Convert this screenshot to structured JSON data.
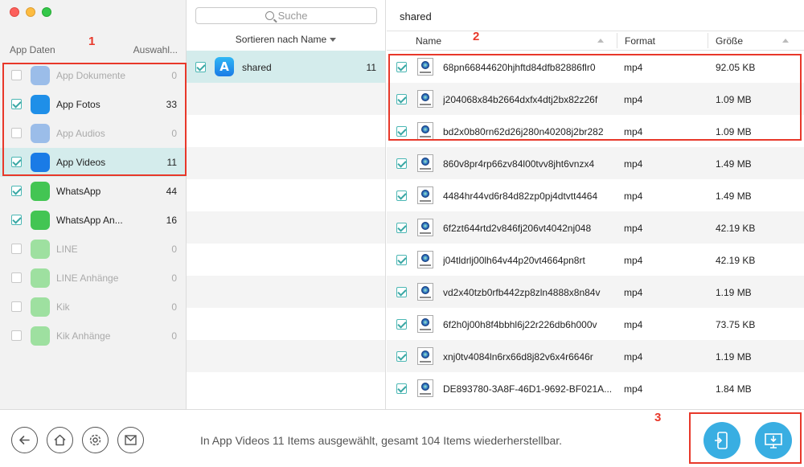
{
  "window": {
    "controls": [
      "close",
      "minimize",
      "maximize"
    ]
  },
  "left": {
    "header_name": "App Daten",
    "header_select": "Auswahl...",
    "categories": [
      {
        "label": "App Dokumente",
        "count": "0",
        "checked": false,
        "disabled": true,
        "icon": "document-icon",
        "color": "#9bbde9"
      },
      {
        "label": "App Fotos",
        "count": "33",
        "checked": true,
        "disabled": false,
        "icon": "photos-icon",
        "color": "#1f8fe8"
      },
      {
        "label": "App Audios",
        "count": "0",
        "checked": false,
        "disabled": true,
        "icon": "audio-icon",
        "color": "#9bbde9"
      },
      {
        "label": "App Videos",
        "count": "11",
        "checked": true,
        "disabled": false,
        "selected": true,
        "icon": "video-icon",
        "color": "#1a7be6"
      },
      {
        "label": "WhatsApp",
        "count": "44",
        "checked": true,
        "disabled": false,
        "icon": "whatsapp-icon",
        "color": "#43c553"
      },
      {
        "label": "WhatsApp An...",
        "count": "16",
        "checked": true,
        "disabled": false,
        "icon": "whatsapp-attachment-icon",
        "color": "#43c553"
      },
      {
        "label": "LINE",
        "count": "0",
        "checked": false,
        "disabled": true,
        "icon": "line-icon",
        "color": "#9ee0a0"
      },
      {
        "label": "LINE Anhänge",
        "count": "0",
        "checked": false,
        "disabled": true,
        "icon": "line-attachment-icon",
        "color": "#9ee0a0"
      },
      {
        "label": "Kik",
        "count": "0",
        "checked": false,
        "disabled": true,
        "icon": "kik-icon",
        "color": "#9ee0a0"
      },
      {
        "label": "Kik Anhänge",
        "count": "0",
        "checked": false,
        "disabled": true,
        "icon": "kik-attachment-icon",
        "color": "#9ee0a0"
      }
    ]
  },
  "middle": {
    "search_placeholder": "Suche",
    "sort_label": "Sortieren nach Name",
    "folders": [
      {
        "label": "shared",
        "count": "11",
        "checked": true,
        "selected": true,
        "icon": "appstore-icon",
        "glyph": "A"
      }
    ]
  },
  "right": {
    "title": "shared",
    "columns": {
      "name": "Name",
      "format": "Format",
      "size": "Größe"
    },
    "files": [
      {
        "name": "68pn66844620hjhftd84dfb82886flr0",
        "format": "mp4",
        "size": "92.05 KB"
      },
      {
        "name": "j204068x84b2664dxfx4dtj2bx82z26f",
        "format": "mp4",
        "size": "1.09 MB"
      },
      {
        "name": "bd2x0b80rn62d26j280n40208j2br282",
        "format": "mp4",
        "size": "1.09 MB"
      },
      {
        "name": "860v8pr4rp66zv84l00tvv8jht6vnzx4",
        "format": "mp4",
        "size": "1.49 MB"
      },
      {
        "name": "4484hr44vd6r84d82zp0pj4dtvtt4464",
        "format": "mp4",
        "size": "1.49 MB"
      },
      {
        "name": "6f2zt644rtd2v846fj206vt4042nj048",
        "format": "mp4",
        "size": "42.19 KB"
      },
      {
        "name": "j04tldrlj00lh64v44p20vt4664pn8rt",
        "format": "mp4",
        "size": "42.19 KB"
      },
      {
        "name": "vd2x40tzb0rfb442zp8zln4888x8n84v",
        "format": "mp4",
        "size": "1.19 MB"
      },
      {
        "name": "6f2h0j00h8f4bbhl6j22r226db6h000v",
        "format": "mp4",
        "size": "73.75 KB"
      },
      {
        "name": "xnj0tv4084ln6rx66d8j82v6x4r6646r",
        "format": "mp4",
        "size": "1.19 MB"
      },
      {
        "name": "DE893780-3A8F-46D1-9692-BF021A...",
        "format": "mp4",
        "size": "1.84 MB"
      }
    ]
  },
  "bottom": {
    "status": "In App Videos 11 Items ausgewählt, gesamt 104 Items wiederherstellbar.",
    "nav_buttons": [
      "back-icon",
      "home-icon",
      "settings-icon",
      "mail-icon"
    ],
    "actions": [
      "to-device-icon",
      "to-computer-icon"
    ]
  },
  "annotations": {
    "label1": "1",
    "label2": "2",
    "label3": "3",
    "color": "#e8382a"
  }
}
